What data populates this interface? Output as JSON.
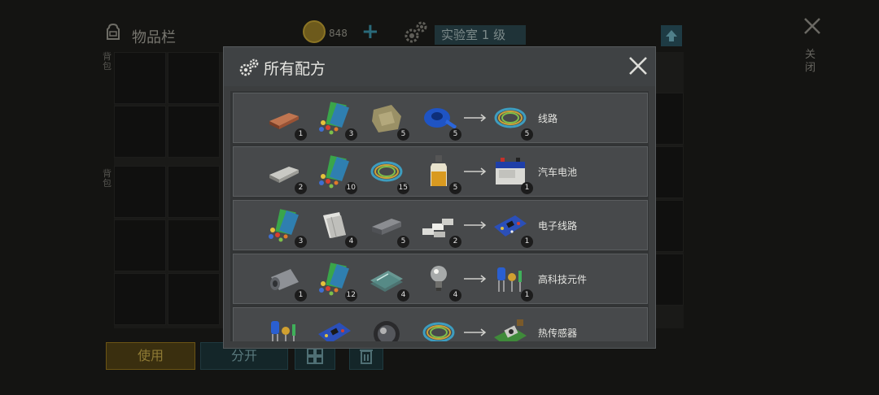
{
  "background": {
    "inventory_title": "物品栏",
    "coins": "848",
    "add_label": "+",
    "lab_label": "实验室 1 级",
    "close_label": "关闭",
    "side_label_top": "背包",
    "side_label_mid": "背包",
    "use_label": "使用",
    "split_label": "分开"
  },
  "dialog": {
    "title": "所有配方",
    "recipes": [
      {
        "ingredients": [
          {
            "icon": "copper-ingot-icon",
            "qty": "1"
          },
          {
            "icon": "electronic-components-icon",
            "qty": "3"
          },
          {
            "icon": "cloth-icon",
            "qty": "5"
          },
          {
            "icon": "blue-tape-icon",
            "qty": "5"
          }
        ],
        "result": {
          "icon": "wire-coil-icon",
          "qty": "5",
          "name": "线路"
        }
      },
      {
        "ingredients": [
          {
            "icon": "metal-ingot-icon",
            "qty": "2"
          },
          {
            "icon": "electronic-components-icon",
            "qty": "10"
          },
          {
            "icon": "wire-coil-icon",
            "qty": "15"
          },
          {
            "icon": "fluid-bottle-icon",
            "qty": "5"
          }
        ],
        "result": {
          "icon": "car-battery-icon",
          "qty": "1",
          "name": "汽车电池"
        }
      },
      {
        "ingredients": [
          {
            "icon": "electronic-components-icon",
            "qty": "3"
          },
          {
            "icon": "paper-stack-icon",
            "qty": "4"
          },
          {
            "icon": "steel-bar-icon",
            "qty": "5"
          },
          {
            "icon": "silver-bars-icon",
            "qty": "2"
          }
        ],
        "result": {
          "icon": "circuit-board-icon",
          "qty": "1",
          "name": "电子线路"
        }
      },
      {
        "ingredients": [
          {
            "icon": "metal-sheet-roll-icon",
            "qty": "1"
          },
          {
            "icon": "electronic-components-icon",
            "qty": "12"
          },
          {
            "icon": "glass-pane-icon",
            "qty": "4"
          },
          {
            "icon": "light-bulb-icon",
            "qty": "4"
          }
        ],
        "result": {
          "icon": "hi-tech-components-icon",
          "qty": "1",
          "name": "高科技元件"
        }
      },
      {
        "ingredients": [
          {
            "icon": "hi-tech-components-icon",
            "qty": ""
          },
          {
            "icon": "circuit-board-icon",
            "qty": ""
          },
          {
            "icon": "lens-icon",
            "qty": ""
          },
          {
            "icon": "wire-coil-icon",
            "qty": ""
          }
        ],
        "result": {
          "icon": "heat-sensor-icon",
          "qty": "",
          "name": "热传感器"
        }
      }
    ]
  }
}
